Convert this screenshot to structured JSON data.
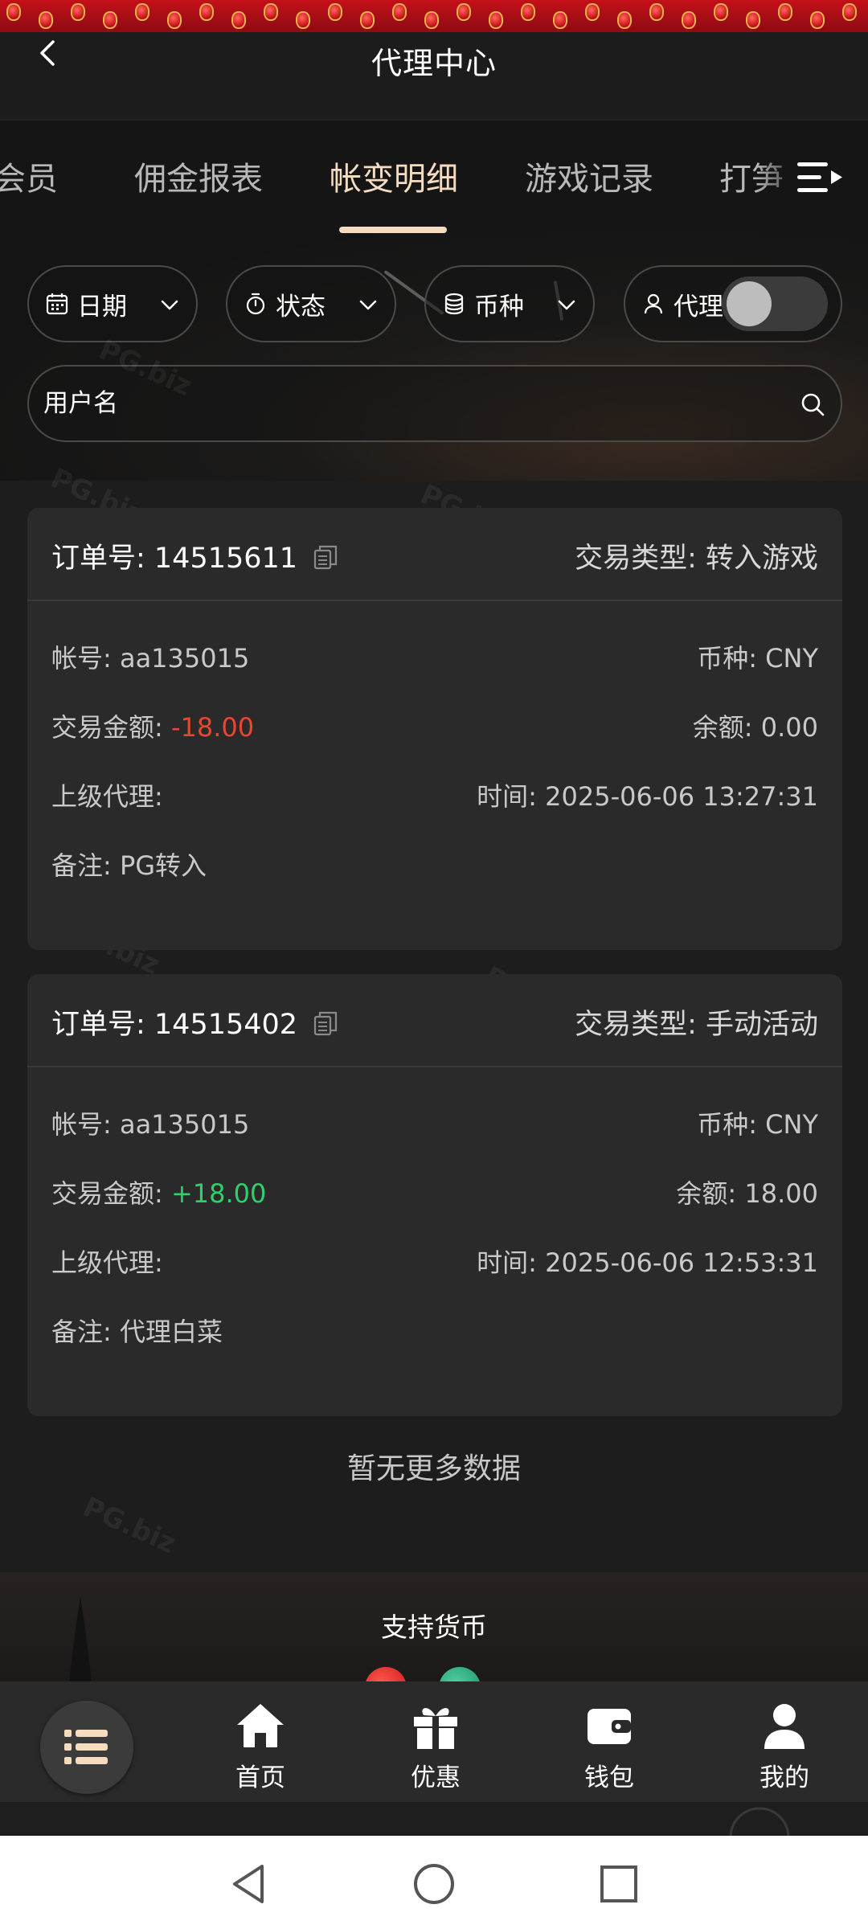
{
  "header": {
    "title": "代理中心"
  },
  "tabs": [
    {
      "label": "会员",
      "active": false
    },
    {
      "label": "佣金报表",
      "active": false
    },
    {
      "label": "帐变明细",
      "active": true
    },
    {
      "label": "游戏记录",
      "active": false
    },
    {
      "label": "打笋",
      "active": false
    }
  ],
  "filters": {
    "date_label": "日期",
    "status_label": "状态",
    "currency_label": "币种",
    "agent_label": "代理",
    "agent_toggle_on": false
  },
  "search": {
    "placeholder": "用户名"
  },
  "records": [
    {
      "order": "订单号: 14515611",
      "type": "交易类型: 转入游戏",
      "account": "帐号: aa135015",
      "currency": "币种: CNY",
      "amount_label": "交易金额: ",
      "amount": "-18.00",
      "balance": "余额: 0.00",
      "parent_agent": "上级代理:",
      "time": "时间: 2025-06-06 13:27:31",
      "remark": "备注: PG转入"
    },
    {
      "order": "订单号: 14515402",
      "type": "交易类型: 手动活动",
      "account": "帐号: aa135015",
      "currency": "币种: CNY",
      "amount_label": "交易金额: ",
      "amount": "+18.00",
      "balance": "余额: 18.00",
      "parent_agent": "上级代理:",
      "time": "时间: 2025-06-06 12:53:31",
      "remark": "备注: 代理白菜"
    }
  ],
  "list_end_text": "暂无更多数据",
  "footer": {
    "support_currency_title": "支持货币"
  },
  "bottom_nav": {
    "items": [
      {
        "label": "首页",
        "icon": "home-icon"
      },
      {
        "label": "优惠",
        "icon": "gift-icon"
      },
      {
        "label": "钱包",
        "icon": "wallet-icon"
      },
      {
        "label": "我的",
        "icon": "user-icon"
      }
    ]
  },
  "colors": {
    "accent": "#f5dcc0",
    "negative": "#e5482f",
    "positive": "#2fd06c",
    "card": "#2a2a2a",
    "background": "#1b1b1b"
  }
}
